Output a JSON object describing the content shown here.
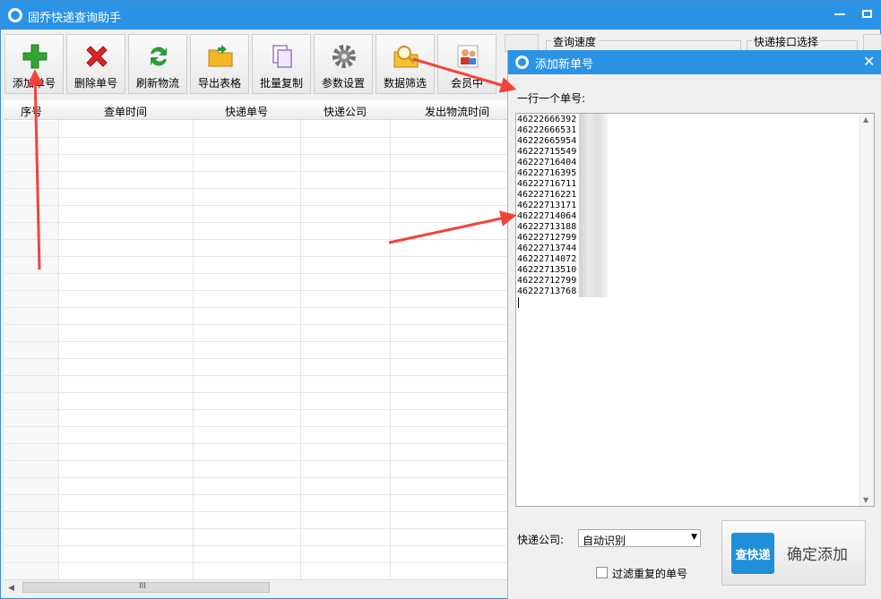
{
  "window": {
    "title": "固乔快递查询助手",
    "min_icon": "minimize-icon",
    "max_icon": "maximize-icon"
  },
  "toolbar": {
    "buttons": [
      {
        "label": "添加单号",
        "icon": "add-icon",
        "color": "#2fa52f"
      },
      {
        "label": "删除单号",
        "icon": "delete-icon",
        "color": "#d9262b"
      },
      {
        "label": "刷新物流",
        "icon": "refresh-icon",
        "color": "#2e9b3f"
      },
      {
        "label": "导出表格",
        "icon": "folder-export-icon",
        "color": "#f2b626"
      },
      {
        "label": "批量复制",
        "icon": "copy-icon",
        "color": "#b08fd0"
      },
      {
        "label": "参数设置",
        "icon": "gear-icon",
        "color": "#777777"
      },
      {
        "label": "数据筛选",
        "icon": "search-filter-icon",
        "color": "#f1c232"
      },
      {
        "label": "会员中",
        "icon": "member-icon",
        "color": "#3f7fd8"
      }
    ]
  },
  "grid": {
    "columns": [
      "序号",
      "查单时间",
      "快递单号",
      "快递公司",
      "发出物流时间"
    ]
  },
  "hscroll": {
    "left_arrow": "◀",
    "grip": "III"
  },
  "right_panel": {
    "speed_label": "查询速度",
    "api_label": "快递接口选择"
  },
  "dialog": {
    "title": "添加新单号",
    "close": "✕",
    "prompt": "一行一个单号:",
    "numbers": [
      "46222666392",
      "46222666531",
      "46222665954",
      "46222715549",
      "46222716404",
      "46222716395",
      "46222716711",
      "46222716221",
      "46222713171",
      "46222714064",
      "46222713188",
      "46222712799",
      "46222713744",
      "46222714072",
      "46222713510",
      "46222712799",
      "46222713768"
    ],
    "company_label": "快递公司:",
    "company_value": "自动识别",
    "filter_label": "过滤重复的单号",
    "filter_checked": false,
    "confirm_logo": "查快递",
    "confirm_label": "确定添加"
  }
}
